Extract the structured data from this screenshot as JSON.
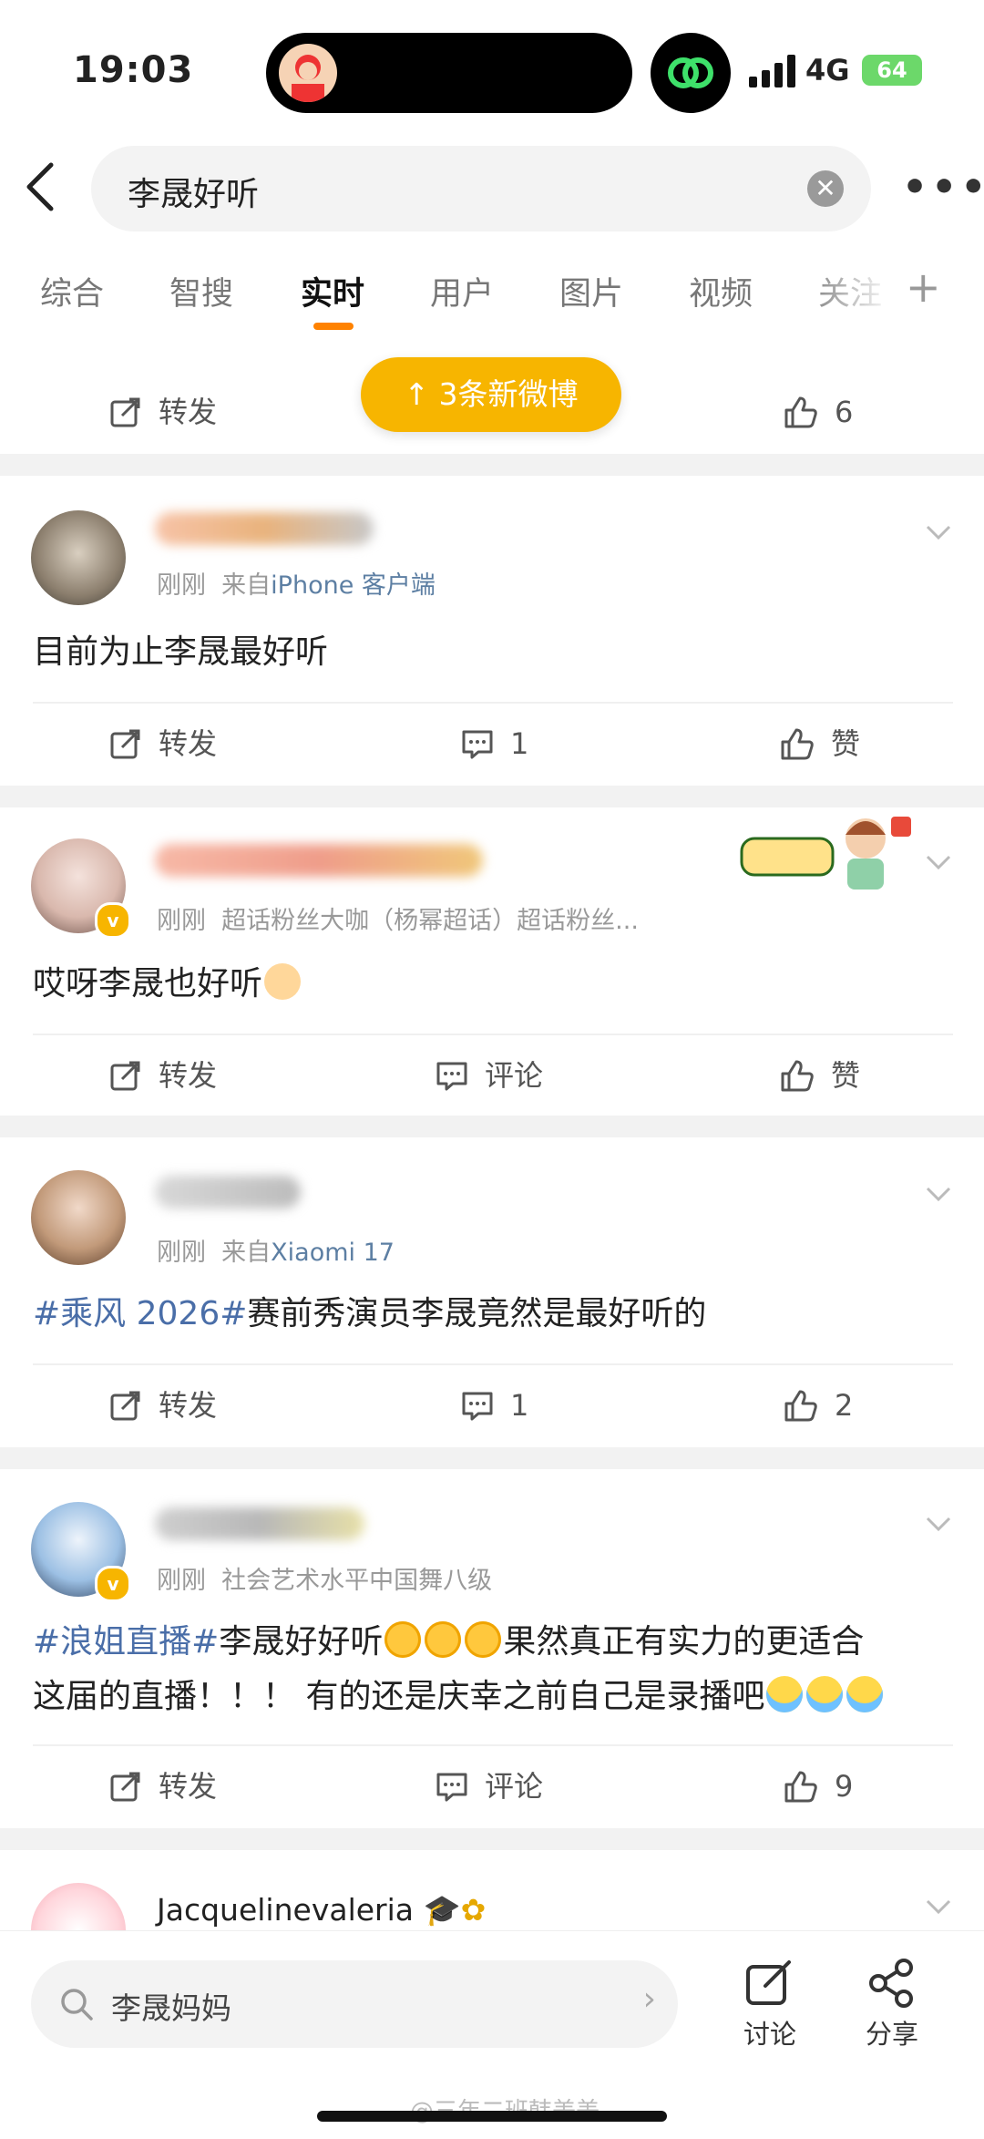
{
  "status": {
    "time": "19:03",
    "network": "4G",
    "battery": "64"
  },
  "search": {
    "query": "李晟好听"
  },
  "tabs": [
    "综合",
    "智搜",
    "实时",
    "用户",
    "图片",
    "视频",
    "关注"
  ],
  "active_tab": "实时",
  "new_posts_toast": "↑ 3条新微博",
  "top_partial": {
    "repost": "转发",
    "like_count": "6"
  },
  "posts": [
    {
      "time": "刚刚",
      "source_prefix": "来自",
      "source": "iPhone 客户端",
      "text": "目前为止李晟最好听",
      "repost": "转发",
      "comment": "1",
      "like": "赞"
    },
    {
      "time": "刚刚",
      "source": "超话粉丝大咖（杨幂超话）超话粉丝...",
      "text": "哎呀李晟也好听",
      "repost": "转发",
      "comment": "评论",
      "like": "赞"
    },
    {
      "time": "刚刚",
      "source_prefix": "来自",
      "source": "Xiaomi 17",
      "tag": "#乘风 2026#",
      "text": "赛前秀演员李晟竟然是最好听的",
      "repost": "转发",
      "comment": "1",
      "like": "2"
    },
    {
      "time": "刚刚",
      "source": "社会艺术水平中国舞八级",
      "tag": "#浪姐直播#",
      "text_a": "李晟好好听",
      "text_b": "果然真正有实力的更适合",
      "text_c": "这届的直播！！！ 有的还是庆幸之前自己是录播吧",
      "repost": "转发",
      "comment": "评论",
      "like": "9"
    }
  ],
  "partial_user": {
    "name": "Jacquelinevaleria"
  },
  "bottom": {
    "search_hint": "李晟妈妈",
    "discuss": "讨论",
    "share": "分享",
    "watermark": "@三年二班韩美美"
  },
  "colors": {
    "accent": "#ff8200",
    "toast": "#f7b500",
    "link": "#4a6ea8"
  },
  "icons": [
    "back-icon",
    "clear-icon",
    "more-icon",
    "repost-icon",
    "comment-icon",
    "like-icon",
    "chevron-down-icon",
    "search-icon",
    "edit-icon",
    "share-icon"
  ]
}
